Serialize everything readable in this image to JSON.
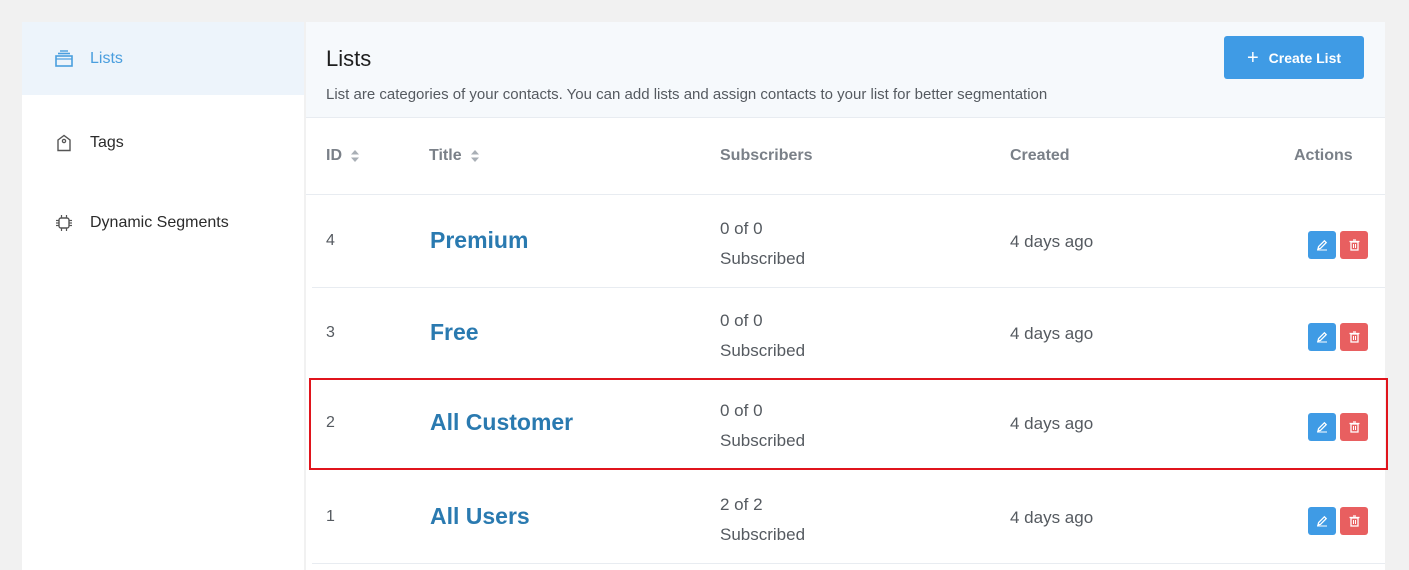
{
  "sidebar": {
    "items": [
      {
        "label": "Lists",
        "icon": "layers-icon",
        "active": true
      },
      {
        "label": "Tags",
        "icon": "tag-icon",
        "active": false
      },
      {
        "label": "Dynamic Segments",
        "icon": "chip-icon",
        "active": false
      }
    ]
  },
  "header": {
    "title": "Lists",
    "description": "List are categories of your contacts. You can add lists and assign contacts to your list for better segmentation",
    "create_label": "Create List",
    "create_icon": "plus-icon"
  },
  "table": {
    "columns": {
      "id": "ID",
      "title": "Title",
      "subscribers": "Subscribers",
      "created": "Created",
      "actions": "Actions"
    },
    "rows": [
      {
        "id": "4",
        "title": "Premium",
        "subs_count": "0 of 0",
        "subs_label": "Subscribed",
        "created": "4 days ago"
      },
      {
        "id": "3",
        "title": "Free",
        "subs_count": "0 of 0",
        "subs_label": "Subscribed",
        "created": "4 days ago"
      },
      {
        "id": "2",
        "title": "All Customer",
        "subs_count": "0 of 0",
        "subs_label": "Subscribed",
        "created": "4 days ago",
        "highlighted": true
      },
      {
        "id": "1",
        "title": "All Users",
        "subs_count": "2 of 2",
        "subs_label": "Subscribed",
        "created": "4 days ago"
      }
    ]
  },
  "colors": {
    "accent": "#3f9be5",
    "danger": "#e85f60",
    "link": "#2a7ab0",
    "highlight_border": "#e0141c",
    "active_bg": "#edf4fb"
  }
}
